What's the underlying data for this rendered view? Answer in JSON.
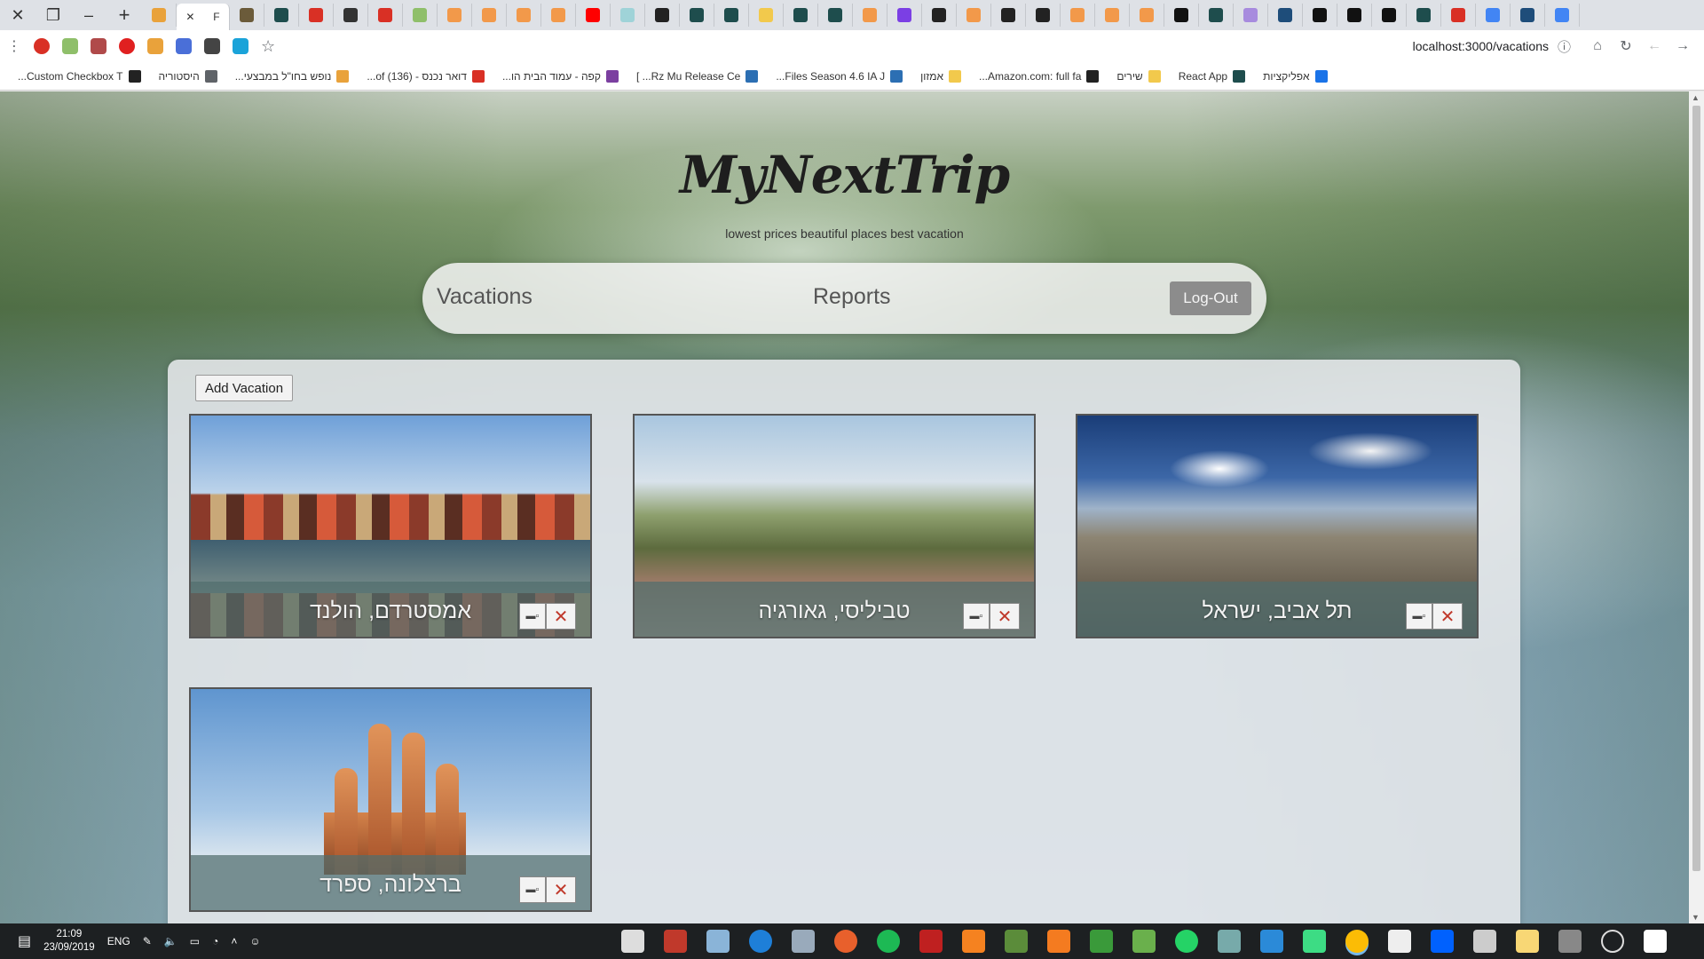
{
  "browser": {
    "active_tab_label": "F",
    "url": "localhost:3000/vacations",
    "bookmarks": [
      {
        "label": "אפליקציות",
        "color": "#1a73e8"
      },
      {
        "label": "React App",
        "color": "#1e4d4d"
      },
      {
        "label": "שירים",
        "color": "#f2c94c"
      },
      {
        "label": "Amazon.com: full fa...",
        "color": "#222222"
      },
      {
        "label": "אמזון",
        "color": "#f2c94c"
      },
      {
        "label": "Files Season 4.6 IA J...",
        "color": "#2c6fb3"
      },
      {
        "label": "Rz Mu Release Ce... ]",
        "color": "#2c6fb3"
      },
      {
        "label": "קפה - עמוד הבית הו...",
        "color": "#7b3fa0"
      },
      {
        "label": "דואר נכנס - (136) of...",
        "color": "#d93025"
      },
      {
        "label": "נופש בחו\"ל במבצעי...",
        "color": "#e9a23b"
      },
      {
        "label": "היסטוריה",
        "color": "#5f6368"
      },
      {
        "label": "Custom Checkbox T...",
        "color": "#222222"
      }
    ]
  },
  "header": {
    "logo": "MyNextTrip",
    "tagline": "lowest prices beautiful places best vacation"
  },
  "nav": {
    "vacations": "Vacations",
    "reports": "Reports",
    "logout": "Log-Out"
  },
  "panel": {
    "add_button": "Add Vacation",
    "cards": [
      {
        "title": "אמסטרדם, הולנד",
        "scene": "amsterdam"
      },
      {
        "title": "טביליסי, גאורגיה",
        "scene": "tbilisi"
      },
      {
        "title": "תל אביב, ישראל",
        "scene": "tel-aviv"
      },
      {
        "title": "ברצלונה, ספרד",
        "scene": "barcelona"
      }
    ],
    "edit_icon": "edit-icon",
    "delete_icon": "close-icon",
    "delete_glyph": "✕",
    "edit_glyph": "▬▫"
  },
  "taskbar": {
    "language": "ENG",
    "time": "21:09",
    "date": "23/09/2019"
  }
}
